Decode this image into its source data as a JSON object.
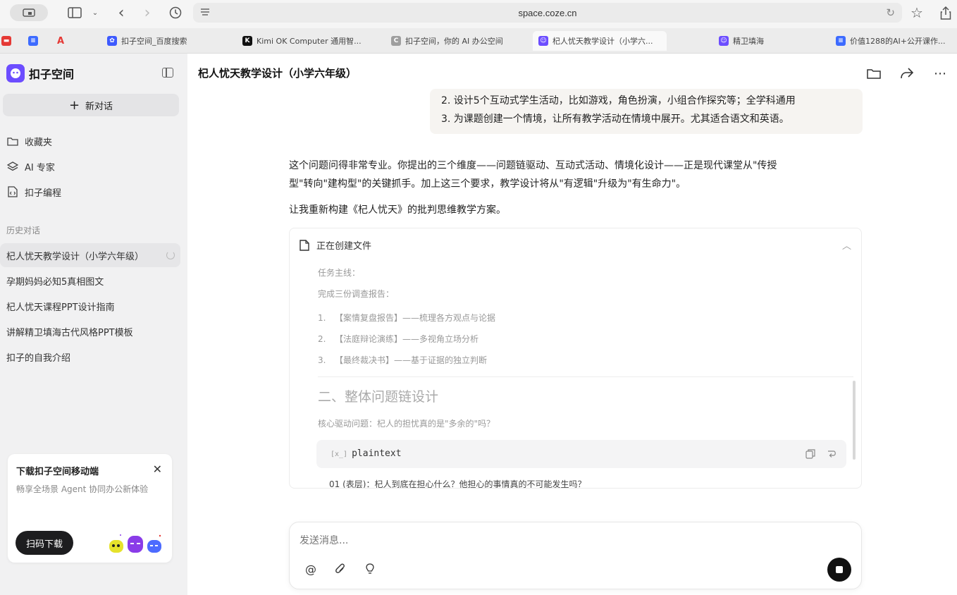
{
  "browser": {
    "url": "space.coze.cn",
    "tabs": [
      {
        "label": "扣子空间_百度搜索",
        "icon": "baidu-paw-icon",
        "color": "#3d5afe"
      },
      {
        "label": "Kimi OK Computer 通用智...",
        "icon": "kimi-icon",
        "color": "#111111"
      },
      {
        "label": "扣子空间，你的 AI 办公空间",
        "icon": "coze-grey-icon",
        "color": "#9e9e9e"
      },
      {
        "label": "杞人忧天教学设计（小学六...",
        "icon": "coze-icon",
        "color": "#6c4dff"
      },
      {
        "label": "精卫填海",
        "icon": "coze-icon",
        "color": "#6c4dff"
      },
      {
        "label": "价值1288的AI+公开课作...",
        "icon": "doc-icon",
        "color": "#3d6bff"
      }
    ]
  },
  "sidebar": {
    "brand": "扣子空间",
    "new_chat": "新对话",
    "nav": [
      {
        "label": "收藏夹",
        "icon": "folder-icon"
      },
      {
        "label": "AI 专家",
        "icon": "layers-icon"
      },
      {
        "label": "扣子编程",
        "icon": "code-file-icon"
      }
    ],
    "history_label": "历史对话",
    "history": [
      "杞人忧天教学设计（小学六年级）",
      "孕期妈妈必知5真相图文",
      "杞人忧天课程PPT设计指南",
      "讲解精卫填海古代风格PPT模板",
      "扣子的自我介绍"
    ],
    "promo": {
      "title": "下载扣子空间移动端",
      "desc": "畅享全场景 Agent 协同办公新体验",
      "button": "扫码下载"
    }
  },
  "main": {
    "title": "杞人忧天教学设计（小学六年级）",
    "user_message_lines": [
      "2. 设计5个互动式学生活动，比如游戏，角色扮演，小组合作探究等；全学科通用",
      "3. 为课题创建一个情境，让所有教学活动在情境中展开。尤其适合语文和英语。"
    ],
    "reply_paragraphs": [
      "这个问题问得非常专业。你提出的三个维度——问题链驱动、互动式活动、情境化设计——正是现代课堂从\"传授",
      "型\"转向\"建构型\"的关键抓手。加上这三个要求，教学设计将从\"有逻辑\"升级为\"有生命力\"。",
      "让我重新构建《杞人忧天》的批判思维教学方案。"
    ],
    "file_card": {
      "status": "正在创建文件",
      "task_label": "任务主线：",
      "complete_label": "完成三份调查报告：",
      "items": [
        {
          "num": "1.",
          "text": "【案情复盘报告】——梳理各方观点与论据"
        },
        {
          "num": "2.",
          "text": "【法庭辩论演练】——多视角立场分析"
        },
        {
          "num": "3.",
          "text": "【最终裁决书】——基于证据的独立判断"
        }
      ],
      "section_heading": "二、整体问题链设计",
      "core_question": "核心驱动问题：杞人的担忧真的是\"多余的\"吗？",
      "code_prefix": "[x_]",
      "code_lang": "plaintext",
      "cutoff_line": "01 (表层)：杞人到底在担心什么？他担心的事情真的不可能发生吗？"
    },
    "composer": {
      "placeholder": "发送消息..."
    }
  }
}
